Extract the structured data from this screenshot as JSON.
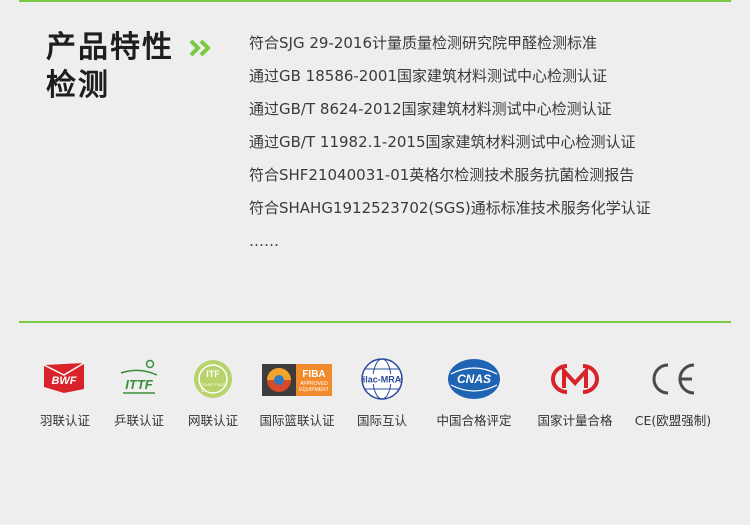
{
  "section": {
    "title_line1": "产品特性",
    "title_line2": "检测",
    "arrow_icon": "double-chevron-right-icon",
    "accent_color": "#7ac943"
  },
  "specs": [
    "符合SJG 29-2016计量质量检测研究院甲醛检测标准",
    "通过GB 18586-2001国家建筑材料测试中心检测认证",
    "通过GB/T 8624-2012国家建筑材料测试中心检测认证",
    "通过GB/T 11982.1-2015国家建筑材料测试中心检测认证",
    "符合SHF21040031-01英格尔检测技术服务抗菌检测报告",
    "符合SHAHG1912523702(SGS)通标标准技术服务化学认证",
    "……"
  ],
  "certifications": [
    {
      "label": "羽联认证",
      "icon": "bwf-logo-icon",
      "logo_text": "BWF"
    },
    {
      "label": "乒联认证",
      "icon": "ittf-logo-icon",
      "logo_text": "ITTF"
    },
    {
      "label": "网联认证",
      "icon": "itf-logo-icon",
      "logo_text": "ITF"
    },
    {
      "label": "国际篮联认证",
      "icon": "fiba-logo-icon",
      "logo_text": "FIBA"
    },
    {
      "label": "国际互认",
      "icon": "ilac-mra-logo-icon",
      "logo_text": "ilac-MRA"
    },
    {
      "label": "中国合格评定",
      "icon": "cnas-logo-icon",
      "logo_text": "CNAS"
    },
    {
      "label": "国家计量合格",
      "icon": "cma-logo-icon",
      "logo_text": "CMA"
    },
    {
      "label": "CE(欧盟强制)",
      "icon": "ce-mark-icon",
      "logo_text": "CE"
    }
  ]
}
